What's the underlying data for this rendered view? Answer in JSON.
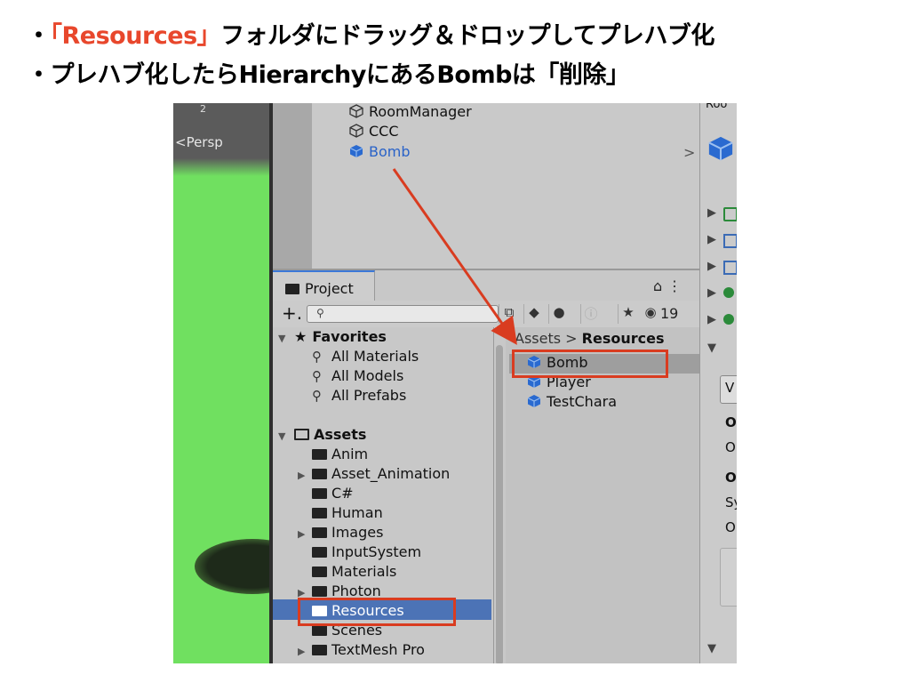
{
  "slide": {
    "bullet1_pre": "・",
    "bullet1_highlight": "「Resources」",
    "bullet1_rest": "フォルダにドラッグ＆ドロップしてプレハブ化",
    "bullet2": "・プレハブ化したらHierarchyにあるBombは「削除」",
    "highlight_color": "#e8472c"
  },
  "scene": {
    "mode_label": "<Persp",
    "gizmo_label": "2"
  },
  "hierarchy": {
    "items": [
      {
        "label": "RoomManager",
        "icon": "gameobject-cube-icon"
      },
      {
        "label": "CCC",
        "icon": "gameobject-cube-icon"
      },
      {
        "label": "Bomb",
        "icon": "prefab-cube-icon",
        "selected": true
      }
    ]
  },
  "inspector": {
    "header": "Roo",
    "letters": [
      "V",
      "O",
      "O",
      "O",
      "Sy",
      "O"
    ]
  },
  "project": {
    "tab_label": "Project",
    "search_placeholder": "",
    "hidden_count": "19",
    "favorites": {
      "label": "Favorites",
      "items": [
        "All Materials",
        "All Models",
        "All Prefabs"
      ]
    },
    "assets": {
      "label": "Assets",
      "folders": [
        {
          "label": "Anim",
          "expandable": false
        },
        {
          "label": "Asset_Animation",
          "expandable": true
        },
        {
          "label": "C#",
          "expandable": false
        },
        {
          "label": "Human",
          "expandable": false
        },
        {
          "label": "Images",
          "expandable": true
        },
        {
          "label": "InputSystem",
          "expandable": false
        },
        {
          "label": "Materials",
          "expandable": false
        },
        {
          "label": "Photon",
          "expandable": true
        },
        {
          "label": "Resources",
          "expandable": false,
          "selected": true
        },
        {
          "label": "Scenes",
          "expandable": false
        },
        {
          "label": "TextMesh Pro",
          "expandable": true
        }
      ]
    },
    "breadcrumb": {
      "root": "Assets",
      "separator": ">",
      "current": "Resources"
    },
    "resources_items": [
      {
        "label": "Bomb",
        "selected": true
      },
      {
        "label": "Player"
      },
      {
        "label": "TestChara"
      }
    ]
  },
  "colors": {
    "selection_blue": "#4c73b6",
    "annotation_red": "#d93c20",
    "prefab_blue": "#2a63c8"
  }
}
